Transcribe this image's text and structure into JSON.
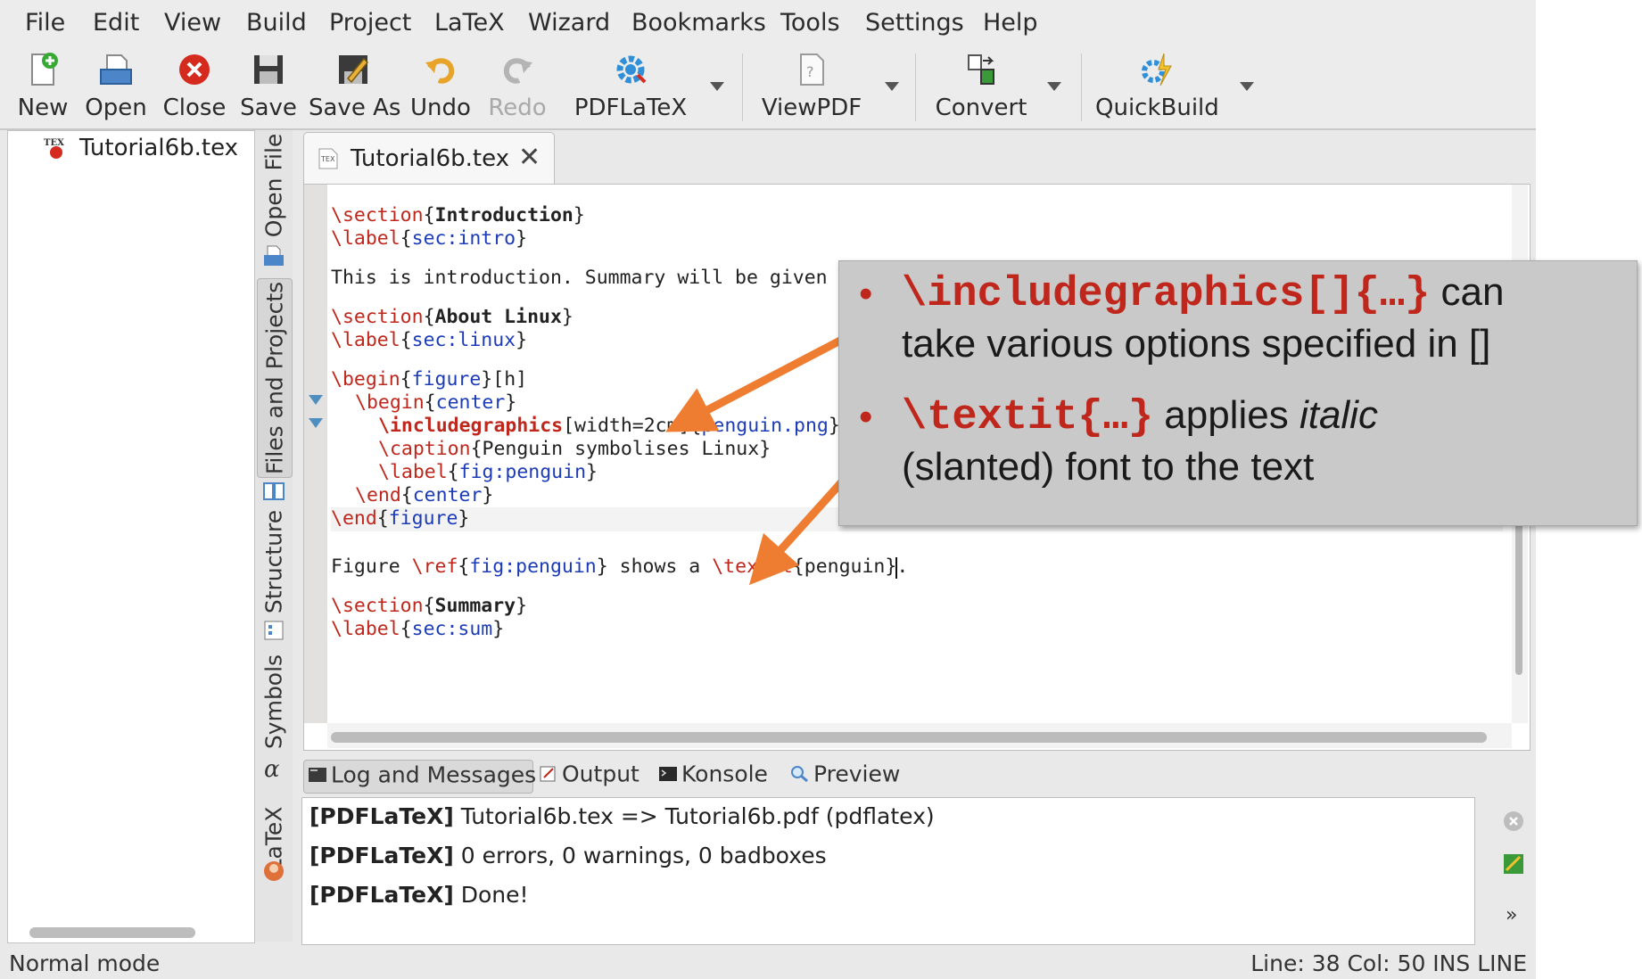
{
  "menu": [
    "File",
    "Edit",
    "View",
    "Build",
    "Project",
    "LaTeX",
    "Wizard",
    "Bookmarks",
    "Tools",
    "Settings",
    "Help"
  ],
  "toolbar": {
    "new": "New",
    "open": "Open",
    "close": "Close",
    "save": "Save",
    "save_as": "Save As",
    "undo": "Undo",
    "redo": "Redo",
    "compile": "PDFLaTeX",
    "view": "ViewPDF",
    "convert": "Convert",
    "quickbuild": "QuickBuild"
  },
  "file_tree": {
    "file": "Tutorial6b.tex"
  },
  "side_tabs": {
    "open_file": "Open File",
    "files_projects": "Files and Projects",
    "structure": "Structure",
    "symbols": "Symbols",
    "latex": "LaTeX"
  },
  "editor": {
    "tab_name": "Tutorial6b.tex",
    "close_glyph": "✕",
    "code": {
      "l1_cmd": "\\section",
      "l1_o": "{",
      "l1_arg": "Introduction",
      "l1_c": "}",
      "l2_cmd": "\\label",
      "l2_o": "{",
      "l2_arg": "sec:intro",
      "l2_c": "}",
      "l3_text": "This is introduction. Summary will be given",
      "l4_cmd": "\\section",
      "l4_o": "{",
      "l4_arg": "About Linux",
      "l4_c": "}",
      "l5_cmd": "\\label",
      "l5_o": "{",
      "l5_arg": "sec:linux",
      "l5_c": "}",
      "l6_cmd": "\\begin",
      "l6_o": "{",
      "l6_arg": "figure",
      "l6_c": "}",
      "l6_opt": "[h]",
      "l7_cmd": "\\begin",
      "l7_o": "{",
      "l7_arg": "center",
      "l7_c": "}",
      "l8_cmd": "\\includegraphics",
      "l8_opt": "[width=2cm]",
      "l8_o": "{",
      "l8_arg": "penguin.png",
      "l8_c": "}",
      "l9_cmd": "\\caption",
      "l9_o": "{",
      "l9_arg": "Penguin symbolises Linux",
      "l9_c": "}",
      "l10_cmd": "\\label",
      "l10_o": "{",
      "l10_arg": "fig:penguin",
      "l10_c": "}",
      "l11_cmd": "\\end",
      "l11_o": "{",
      "l11_arg": "center",
      "l11_c": "}",
      "l12_cmd": "\\end",
      "l12_o": "{",
      "l12_arg": "figure",
      "l12_c": "}",
      "l13_t1": "Figure ",
      "l13_cmd": "\\ref",
      "l13_o": "{",
      "l13_arg": "fig:penguin",
      "l13_c": "}",
      "l13_t2": " shows a ",
      "l13_cmd2": "\\textit",
      "l13_o2": "{",
      "l13_arg2": "penguin",
      "l13_c2": "}",
      "l13_end": ".",
      "l14_cmd": "\\section",
      "l14_o": "{",
      "l14_arg": "Summary",
      "l14_c": "}",
      "l15_cmd": "\\label",
      "l15_o": "{",
      "l15_arg": "sec:sum",
      "l15_c": "}"
    }
  },
  "log_tabs": [
    "Log and Messages",
    "Output",
    "Konsole",
    "Preview"
  ],
  "log": [
    {
      "tag": "[PDFLaTeX]",
      "msg": " Tutorial6b.tex => Tutorial6b.pdf (pdflatex)"
    },
    {
      "tag": "[PDFLaTeX]",
      "msg": " 0 errors, 0 warnings, 0 badboxes"
    },
    {
      "tag": "[PDFLaTeX]",
      "msg": " Done!"
    }
  ],
  "status": {
    "mode": "Normal mode",
    "position": "Line: 38 Col: 50  INS  LINE"
  },
  "callout": {
    "bullet": "•",
    "b1_code": "\\includegraphics[]{…}",
    "b1_text1": " can",
    "b1_text2": "take various options specified in []",
    "b2_code": "\\textit{…}",
    "b2_text1": "  applies ",
    "b2_italic": "italic",
    "b2_text2": "(slanted) font to the text"
  },
  "colors": {
    "keyword": "#c0271c",
    "argument": "#1c3bb9",
    "arrow": "#ee7d31",
    "callout_bg": "#c9c9c9"
  }
}
